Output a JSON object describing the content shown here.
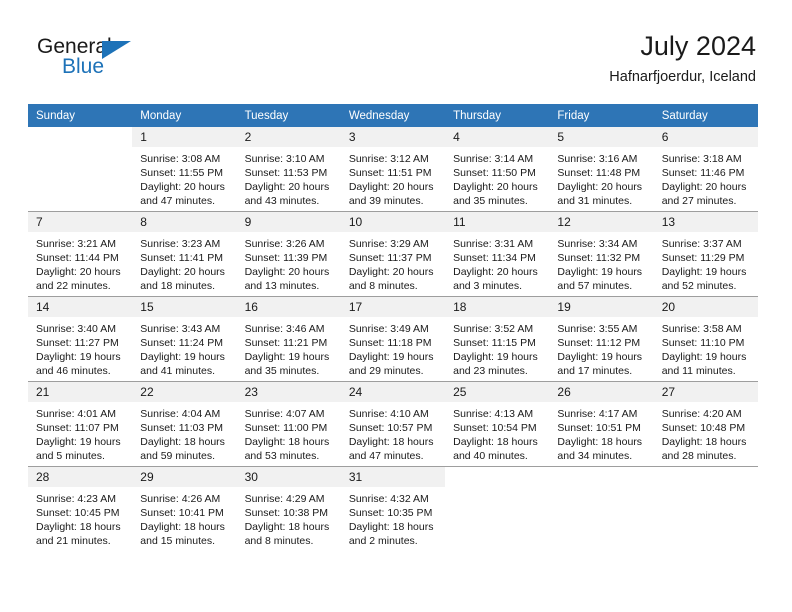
{
  "brand": {
    "name_part1": "General",
    "name_part2": "Blue",
    "accent_color": "#1d72b8",
    "flag_icon": "triangle-flag-icon"
  },
  "header": {
    "title": "July 2024",
    "subtitle": "Hafnarfjoerdur, Iceland"
  },
  "theme": {
    "header_row_bg": "#2e75b6",
    "daynum_bg": "#f1f1f1",
    "grid_line": "#9e9e9e",
    "text": "#1a1a1a"
  },
  "calendar": {
    "weekday_headers": [
      "Sunday",
      "Monday",
      "Tuesday",
      "Wednesday",
      "Thursday",
      "Friday",
      "Saturday"
    ],
    "weeks": [
      [
        {
          "day": "",
          "blank": true,
          "sunrise": "",
          "sunset": "",
          "daylight_line1": "",
          "daylight_line2": ""
        },
        {
          "day": "1",
          "sunrise": "Sunrise: 3:08 AM",
          "sunset": "Sunset: 11:55 PM",
          "daylight_line1": "Daylight: 20 hours",
          "daylight_line2": "and 47 minutes."
        },
        {
          "day": "2",
          "sunrise": "Sunrise: 3:10 AM",
          "sunset": "Sunset: 11:53 PM",
          "daylight_line1": "Daylight: 20 hours",
          "daylight_line2": "and 43 minutes."
        },
        {
          "day": "3",
          "sunrise": "Sunrise: 3:12 AM",
          "sunset": "Sunset: 11:51 PM",
          "daylight_line1": "Daylight: 20 hours",
          "daylight_line2": "and 39 minutes."
        },
        {
          "day": "4",
          "sunrise": "Sunrise: 3:14 AM",
          "sunset": "Sunset: 11:50 PM",
          "daylight_line1": "Daylight: 20 hours",
          "daylight_line2": "and 35 minutes."
        },
        {
          "day": "5",
          "sunrise": "Sunrise: 3:16 AM",
          "sunset": "Sunset: 11:48 PM",
          "daylight_line1": "Daylight: 20 hours",
          "daylight_line2": "and 31 minutes."
        },
        {
          "day": "6",
          "sunrise": "Sunrise: 3:18 AM",
          "sunset": "Sunset: 11:46 PM",
          "daylight_line1": "Daylight: 20 hours",
          "daylight_line2": "and 27 minutes."
        }
      ],
      [
        {
          "day": "7",
          "sunrise": "Sunrise: 3:21 AM",
          "sunset": "Sunset: 11:44 PM",
          "daylight_line1": "Daylight: 20 hours",
          "daylight_line2": "and 22 minutes."
        },
        {
          "day": "8",
          "sunrise": "Sunrise: 3:23 AM",
          "sunset": "Sunset: 11:41 PM",
          "daylight_line1": "Daylight: 20 hours",
          "daylight_line2": "and 18 minutes."
        },
        {
          "day": "9",
          "sunrise": "Sunrise: 3:26 AM",
          "sunset": "Sunset: 11:39 PM",
          "daylight_line1": "Daylight: 20 hours",
          "daylight_line2": "and 13 minutes."
        },
        {
          "day": "10",
          "sunrise": "Sunrise: 3:29 AM",
          "sunset": "Sunset: 11:37 PM",
          "daylight_line1": "Daylight: 20 hours",
          "daylight_line2": "and 8 minutes."
        },
        {
          "day": "11",
          "sunrise": "Sunrise: 3:31 AM",
          "sunset": "Sunset: 11:34 PM",
          "daylight_line1": "Daylight: 20 hours",
          "daylight_line2": "and 3 minutes."
        },
        {
          "day": "12",
          "sunrise": "Sunrise: 3:34 AM",
          "sunset": "Sunset: 11:32 PM",
          "daylight_line1": "Daylight: 19 hours",
          "daylight_line2": "and 57 minutes."
        },
        {
          "day": "13",
          "sunrise": "Sunrise: 3:37 AM",
          "sunset": "Sunset: 11:29 PM",
          "daylight_line1": "Daylight: 19 hours",
          "daylight_line2": "and 52 minutes."
        }
      ],
      [
        {
          "day": "14",
          "sunrise": "Sunrise: 3:40 AM",
          "sunset": "Sunset: 11:27 PM",
          "daylight_line1": "Daylight: 19 hours",
          "daylight_line2": "and 46 minutes."
        },
        {
          "day": "15",
          "sunrise": "Sunrise: 3:43 AM",
          "sunset": "Sunset: 11:24 PM",
          "daylight_line1": "Daylight: 19 hours",
          "daylight_line2": "and 41 minutes."
        },
        {
          "day": "16",
          "sunrise": "Sunrise: 3:46 AM",
          "sunset": "Sunset: 11:21 PM",
          "daylight_line1": "Daylight: 19 hours",
          "daylight_line2": "and 35 minutes."
        },
        {
          "day": "17",
          "sunrise": "Sunrise: 3:49 AM",
          "sunset": "Sunset: 11:18 PM",
          "daylight_line1": "Daylight: 19 hours",
          "daylight_line2": "and 29 minutes."
        },
        {
          "day": "18",
          "sunrise": "Sunrise: 3:52 AM",
          "sunset": "Sunset: 11:15 PM",
          "daylight_line1": "Daylight: 19 hours",
          "daylight_line2": "and 23 minutes."
        },
        {
          "day": "19",
          "sunrise": "Sunrise: 3:55 AM",
          "sunset": "Sunset: 11:12 PM",
          "daylight_line1": "Daylight: 19 hours",
          "daylight_line2": "and 17 minutes."
        },
        {
          "day": "20",
          "sunrise": "Sunrise: 3:58 AM",
          "sunset": "Sunset: 11:10 PM",
          "daylight_line1": "Daylight: 19 hours",
          "daylight_line2": "and 11 minutes."
        }
      ],
      [
        {
          "day": "21",
          "sunrise": "Sunrise: 4:01 AM",
          "sunset": "Sunset: 11:07 PM",
          "daylight_line1": "Daylight: 19 hours",
          "daylight_line2": "and 5 minutes."
        },
        {
          "day": "22",
          "sunrise": "Sunrise: 4:04 AM",
          "sunset": "Sunset: 11:03 PM",
          "daylight_line1": "Daylight: 18 hours",
          "daylight_line2": "and 59 minutes."
        },
        {
          "day": "23",
          "sunrise": "Sunrise: 4:07 AM",
          "sunset": "Sunset: 11:00 PM",
          "daylight_line1": "Daylight: 18 hours",
          "daylight_line2": "and 53 minutes."
        },
        {
          "day": "24",
          "sunrise": "Sunrise: 4:10 AM",
          "sunset": "Sunset: 10:57 PM",
          "daylight_line1": "Daylight: 18 hours",
          "daylight_line2": "and 47 minutes."
        },
        {
          "day": "25",
          "sunrise": "Sunrise: 4:13 AM",
          "sunset": "Sunset: 10:54 PM",
          "daylight_line1": "Daylight: 18 hours",
          "daylight_line2": "and 40 minutes."
        },
        {
          "day": "26",
          "sunrise": "Sunrise: 4:17 AM",
          "sunset": "Sunset: 10:51 PM",
          "daylight_line1": "Daylight: 18 hours",
          "daylight_line2": "and 34 minutes."
        },
        {
          "day": "27",
          "sunrise": "Sunrise: 4:20 AM",
          "sunset": "Sunset: 10:48 PM",
          "daylight_line1": "Daylight: 18 hours",
          "daylight_line2": "and 28 minutes."
        }
      ],
      [
        {
          "day": "28",
          "sunrise": "Sunrise: 4:23 AM",
          "sunset": "Sunset: 10:45 PM",
          "daylight_line1": "Daylight: 18 hours",
          "daylight_line2": "and 21 minutes."
        },
        {
          "day": "29",
          "sunrise": "Sunrise: 4:26 AM",
          "sunset": "Sunset: 10:41 PM",
          "daylight_line1": "Daylight: 18 hours",
          "daylight_line2": "and 15 minutes."
        },
        {
          "day": "30",
          "sunrise": "Sunrise: 4:29 AM",
          "sunset": "Sunset: 10:38 PM",
          "daylight_line1": "Daylight: 18 hours",
          "daylight_line2": "and 8 minutes."
        },
        {
          "day": "31",
          "sunrise": "Sunrise: 4:32 AM",
          "sunset": "Sunset: 10:35 PM",
          "daylight_line1": "Daylight: 18 hours",
          "daylight_line2": "and 2 minutes."
        },
        {
          "day": "",
          "blank": true,
          "sunrise": "",
          "sunset": "",
          "daylight_line1": "",
          "daylight_line2": ""
        },
        {
          "day": "",
          "blank": true,
          "sunrise": "",
          "sunset": "",
          "daylight_line1": "",
          "daylight_line2": ""
        },
        {
          "day": "",
          "blank": true,
          "sunrise": "",
          "sunset": "",
          "daylight_line1": "",
          "daylight_line2": ""
        }
      ]
    ]
  }
}
